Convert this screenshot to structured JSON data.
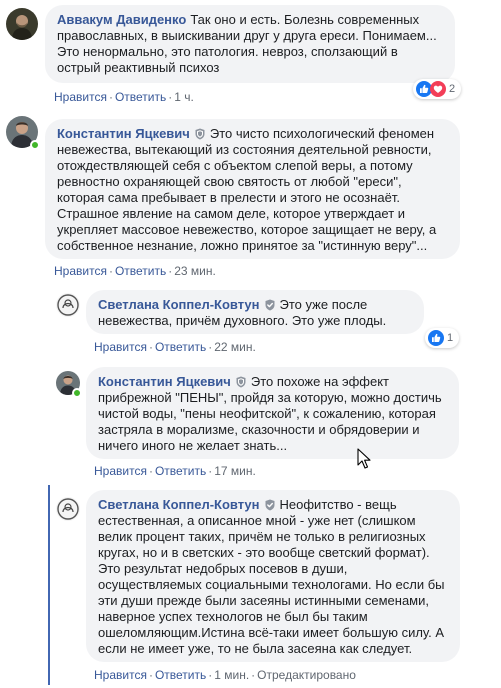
{
  "colors": {
    "link": "#385898",
    "bubble": "#f2f3f5",
    "meta": "#606770",
    "online": "#42b72a",
    "like": "#1877f2",
    "love": "#f33e58",
    "thread": "#4267b2"
  },
  "comments": [
    {
      "author": "Аввакум Давиденко",
      "text": "Так оно и есть. Болезнь современных православных, в выискивании друг у друга ереси. Понимаем... Это ненормально, это патология. невроз, сползающий в острый реактивный психоз",
      "like_label": "Нравится",
      "reply_label": "Ответить",
      "time": "1 ч.",
      "reaction_count": "2",
      "reaction_icons": [
        "like-icon",
        "love-icon"
      ]
    },
    {
      "author": "Константин Яцкевич",
      "text": "Это чисто психологический феномен невежества, вытекающий из состояния деятельной ревности, отождествляющей себя с объектом слепой веры, а потому ревностно охраняющей свою святость от любой \"ереси\", которая сама пребывает в прелести и этого не осознаёт. Страшное явление на самом деле, которое утверждает и укрепляет массовое невежество, которое защищает не веру, а собственное незнание, ложно принятое за \"истинную веру\"...",
      "like_label": "Нравится",
      "reply_label": "Ответить",
      "time": "23 мин.",
      "badge": "shield-badge-icon"
    },
    {
      "author": "Светлана Коппел-Ковтун",
      "text": "Это уже после невежества, причём духовного. Это уже плоды.",
      "like_label": "Нравится",
      "reply_label": "Ответить",
      "time": "22 мин.",
      "reaction_count": "1",
      "reaction_icons": [
        "like-icon"
      ],
      "badge": "shield-check-badge-icon"
    },
    {
      "author": "Константин Яцкевич",
      "text": "Это похоже на эффект прибрежной \"ПЕНЫ\", пройдя за которую, можно достичь чистой воды, \"пены неофитской\", к сожалению, которая застряла в морализме, сказочности и обрядоверии и ничего иного не желает знать...",
      "like_label": "Нравится",
      "reply_label": "Ответить",
      "time": "17 мин.",
      "badge": "shield-badge-icon"
    },
    {
      "author": "Светлана Коппел-Ковтун",
      "text": "Неофитство - вещь естественная, а описанное мной - уже нет (слишком велик процент таких, причём не только в религиозных кругах, но и в светских - это вообще светский формат). Это результат недобрых посевов в души, осуществляемых социальными технологами. Но если бы эти души прежде были засеяны истинными семенами, наверное успех технологов не был бы таким ошеломляющим.Истина всё-таки имеет большую силу. А если не имеет уже, то не была засеяна как следует.",
      "like_label": "Нравится",
      "reply_label": "Ответить",
      "time": "1 мин.",
      "edited_label": "Отредактировано",
      "badge": "shield-check-badge-icon"
    }
  ]
}
